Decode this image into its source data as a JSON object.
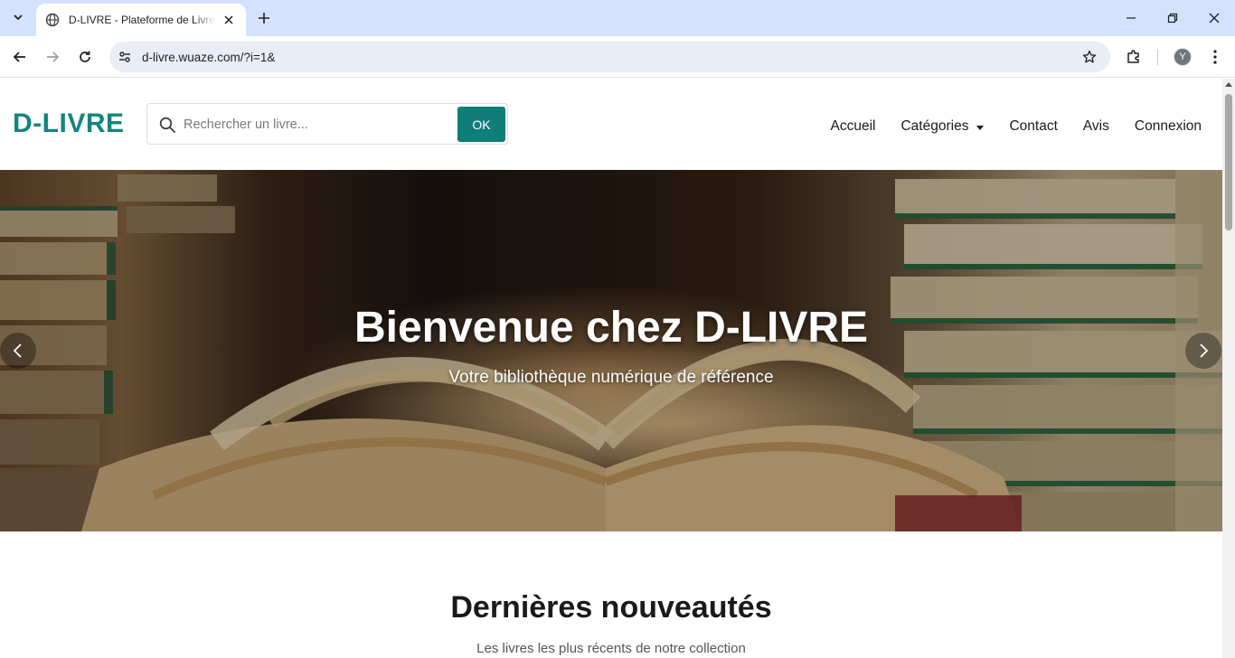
{
  "browser": {
    "tab_title": "D-LIVRE - Plateforme de Livres en ligne",
    "url": "d-livre.wuaze.com/?i=1&",
    "profile_initial": "Y"
  },
  "site": {
    "logo": "D-LIVRE",
    "search": {
      "placeholder": "Rechercher un livre...",
      "button_label": "OK"
    },
    "nav": {
      "home": "Accueil",
      "categories": "Catégories",
      "contact": "Contact",
      "reviews": "Avis",
      "login": "Connexion"
    },
    "hero": {
      "title": "Bienvenue chez D-LIVRE",
      "subtitle": "Votre bibliothèque numérique de référence"
    },
    "section": {
      "title": "Dernières nouveautés",
      "subtitle": "Les livres les plus récents de notre collection"
    }
  },
  "colors": {
    "brand": "#14857e",
    "button": "#0f7d78",
    "chrome": "#d3e3fd"
  }
}
